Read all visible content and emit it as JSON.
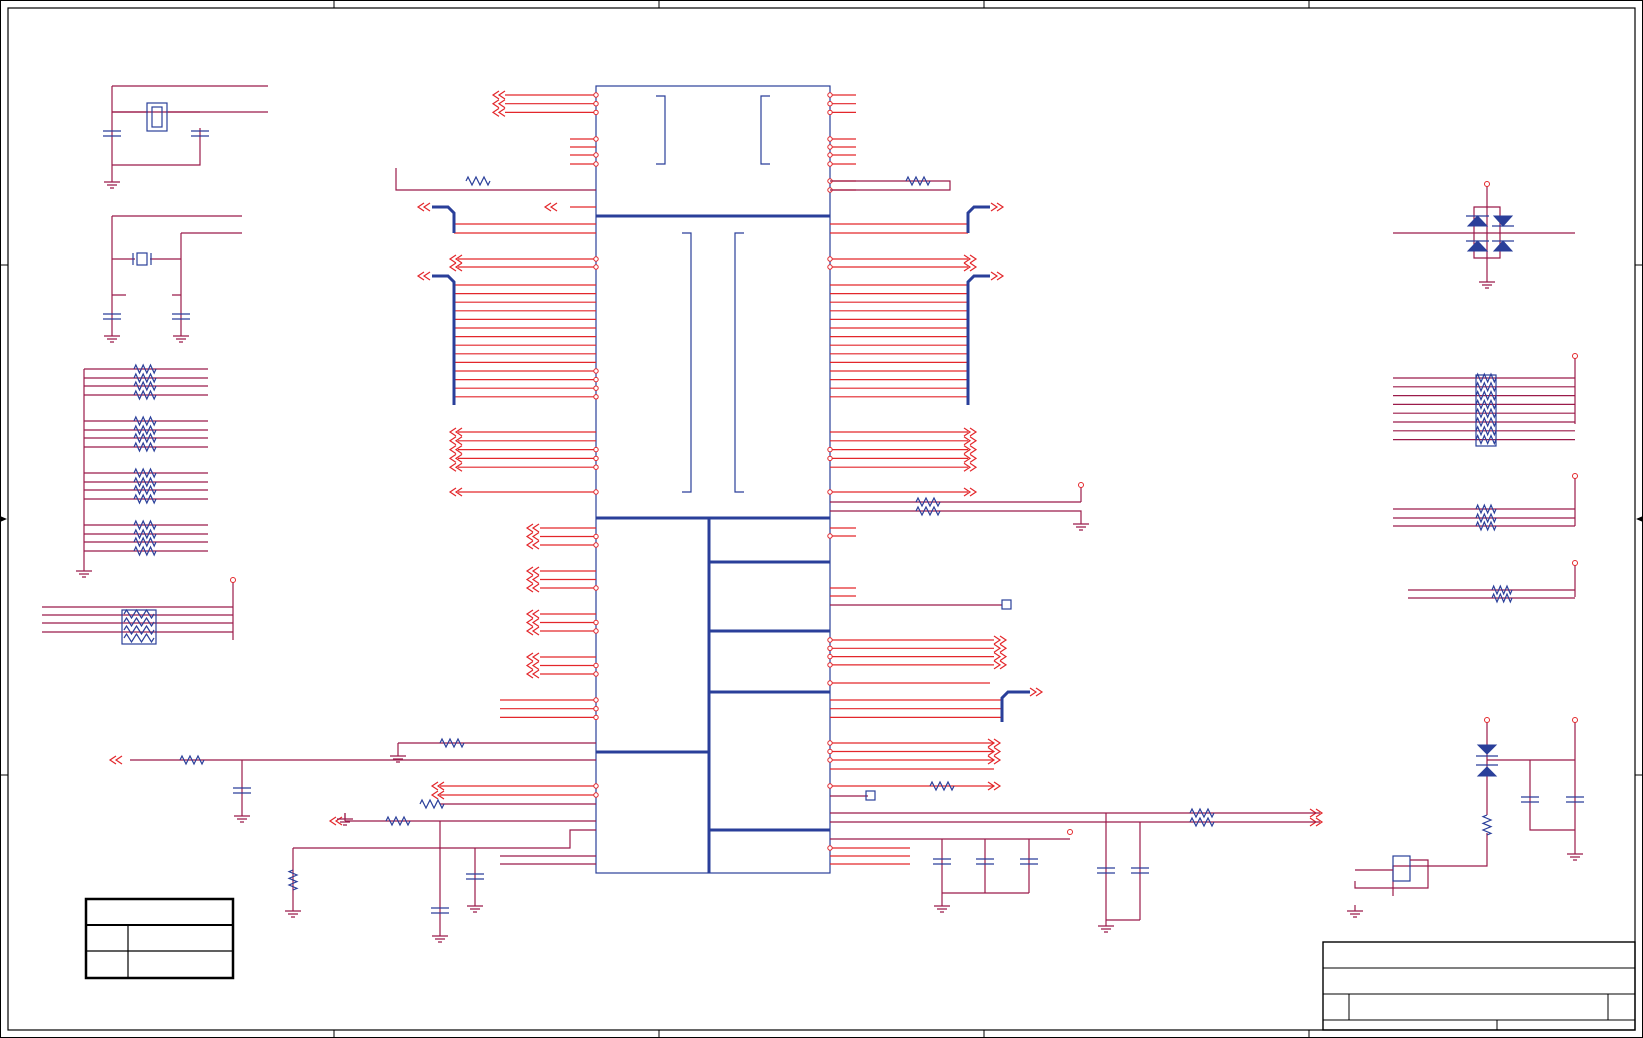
{
  "drawing": {
    "colors": {
      "wire": "#9b1b4a",
      "pin": "#e3272b",
      "component": "#2a3f9a",
      "frame": "#000000",
      "background": "#ffffff"
    },
    "components": {
      "ic": "main-ic",
      "crystals": [
        "crystal-y1",
        "crystal-y2"
      ],
      "diode_bridge": "esd-diode-array",
      "resistor_arrays": [
        "pull-resistor-bank",
        "resistor-network"
      ],
      "connector": "header-connector"
    },
    "frame": {
      "has_title_block": true,
      "has_revision_block": true
    }
  }
}
